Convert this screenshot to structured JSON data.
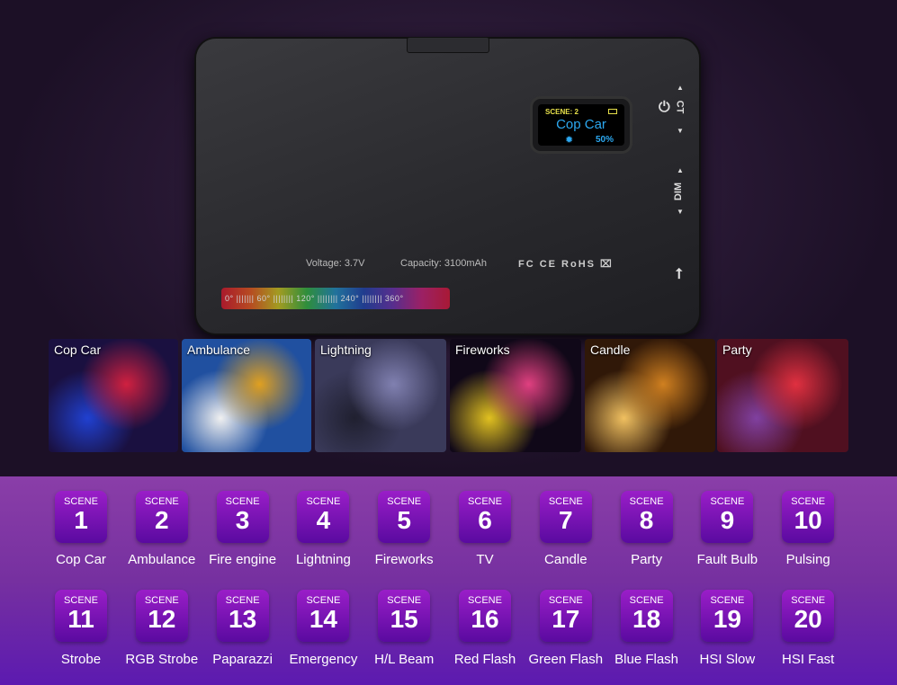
{
  "device": {
    "screen": {
      "scene_label": "SCENE:",
      "scene_number": "2",
      "scene_name": "Cop Car",
      "brightness": "50%"
    },
    "buttons": {
      "ct": "CT",
      "dim": "DIM"
    },
    "voltage": "Voltage: 3.7V",
    "capacity": "Capacity: 3100mAh",
    "certifications": "FC CE RoHS ⌧",
    "hue_scale": "0° ||||||| 60° |||||||| 120° |||||||| 240° |||||||| 360°"
  },
  "photos": [
    {
      "label": "Cop Car",
      "colors": [
        "#1a1040",
        "#d02040",
        "#2040d0"
      ]
    },
    {
      "label": "Ambulance",
      "colors": [
        "#2050a0",
        "#e0a020",
        "#f0f0f0"
      ]
    },
    {
      "label": "Lightning",
      "colors": [
        "#3a3a5a",
        "#8080b0",
        "#202030"
      ]
    },
    {
      "label": "Fireworks",
      "colors": [
        "#100818",
        "#e04080",
        "#e0c020"
      ]
    },
    {
      "label": "Candle",
      "colors": [
        "#301808",
        "#d08020",
        "#f0c060"
      ]
    },
    {
      "label": "Party",
      "colors": [
        "#501020",
        "#e03040",
        "#8040a0"
      ]
    }
  ],
  "scene_word": "SCENE",
  "scenes": [
    {
      "n": "1",
      "name": "Cop Car"
    },
    {
      "n": "2",
      "name": "Ambulance"
    },
    {
      "n": "3",
      "name": "Fire engine"
    },
    {
      "n": "4",
      "name": "Lightning"
    },
    {
      "n": "5",
      "name": "Fireworks"
    },
    {
      "n": "6",
      "name": "TV"
    },
    {
      "n": "7",
      "name": "Candle"
    },
    {
      "n": "8",
      "name": "Party"
    },
    {
      "n": "9",
      "name": "Fault Bulb"
    },
    {
      "n": "10",
      "name": "Pulsing"
    },
    {
      "n": "11",
      "name": "Strobe"
    },
    {
      "n": "12",
      "name": "RGB Strobe"
    },
    {
      "n": "13",
      "name": "Paparazzi"
    },
    {
      "n": "14",
      "name": "Emergency"
    },
    {
      "n": "15",
      "name": "H/L Beam"
    },
    {
      "n": "16",
      "name": "Red Flash"
    },
    {
      "n": "17",
      "name": "Green Flash"
    },
    {
      "n": "18",
      "name": "Blue Flash"
    },
    {
      "n": "19",
      "name": "HSI Slow"
    },
    {
      "n": "20",
      "name": "HSI Fast"
    }
  ]
}
